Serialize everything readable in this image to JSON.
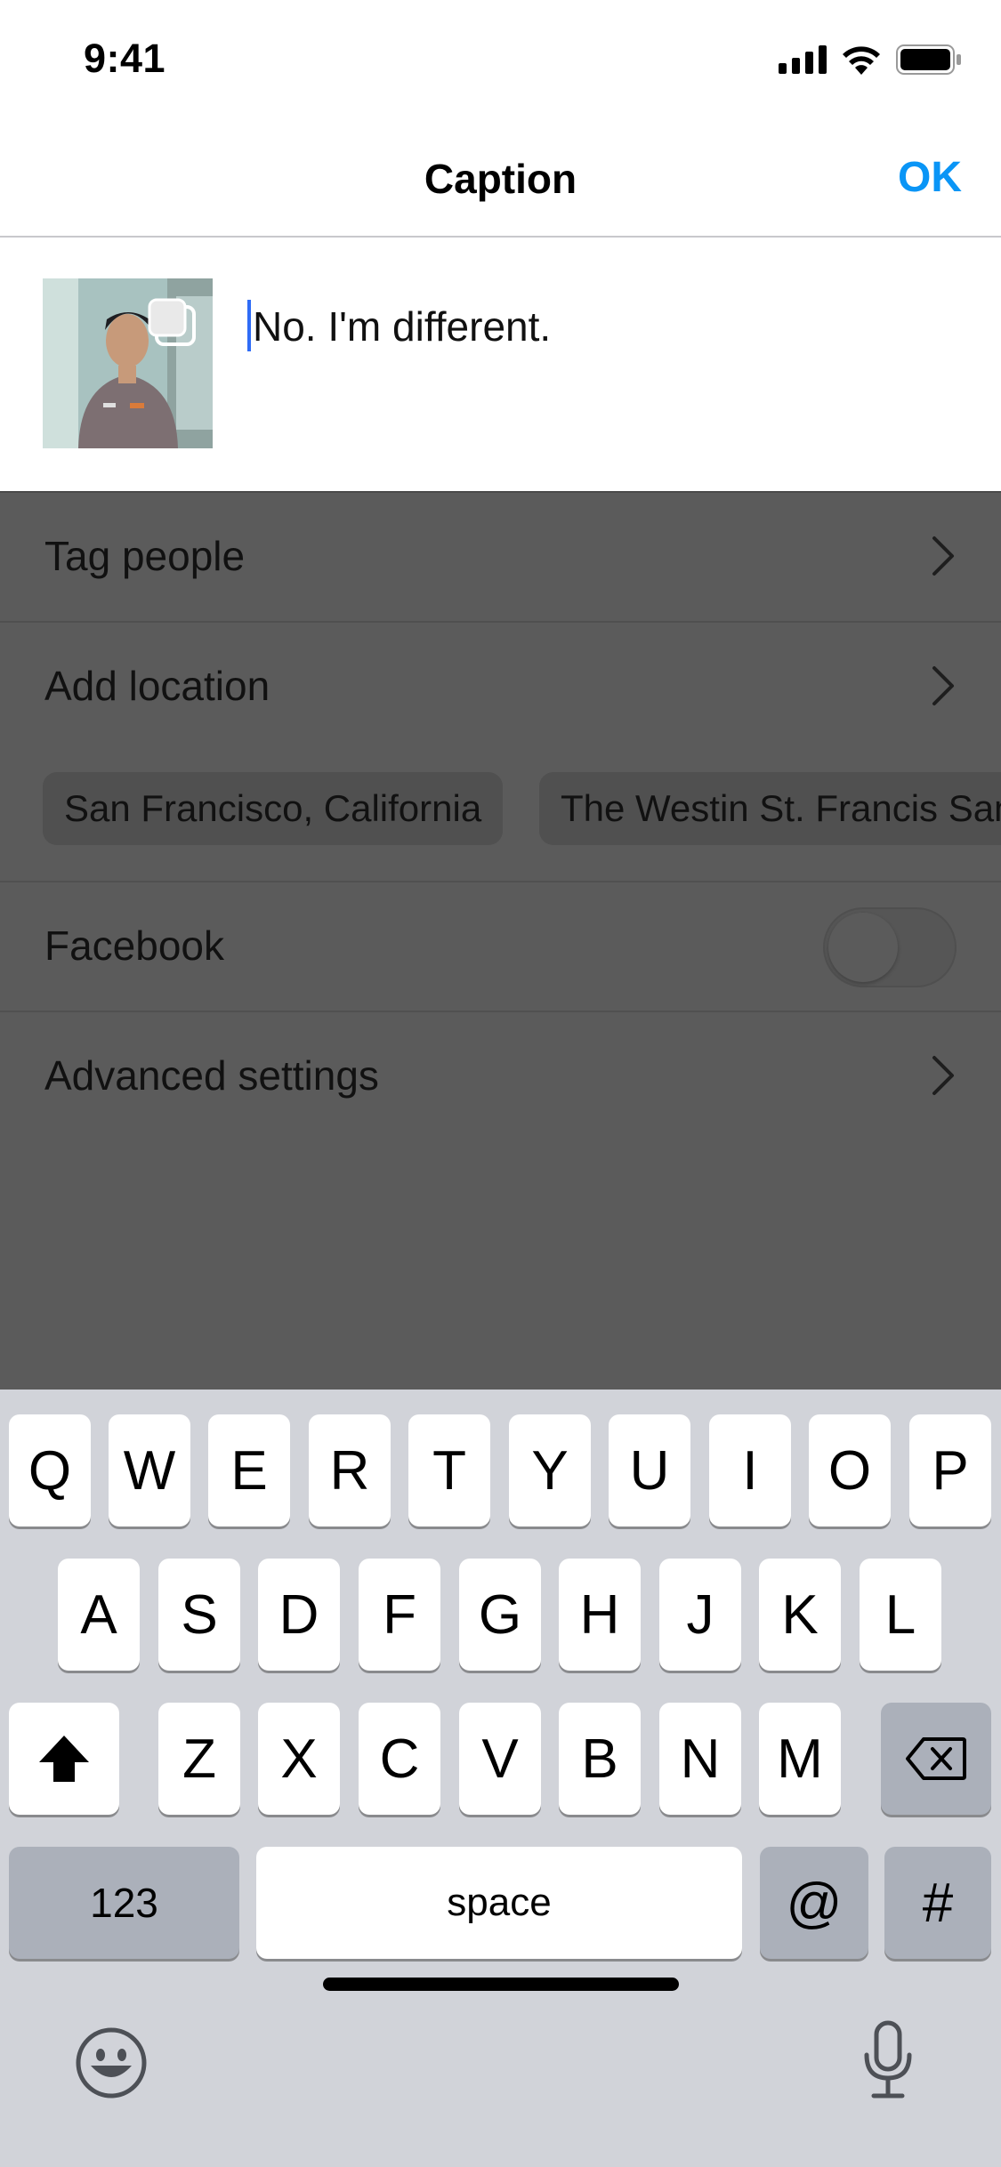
{
  "status_bar": {
    "time": "9:41"
  },
  "nav": {
    "title": "Caption",
    "ok_label": "OK"
  },
  "caption": {
    "text": "No. I'm different."
  },
  "rows": {
    "tag_people": "Tag people",
    "add_location": "Add location",
    "facebook": "Facebook",
    "facebook_enabled": false,
    "advanced_settings": "Advanced settings"
  },
  "location_suggestions": [
    "San Francisco, California",
    "The Westin St. Francis San Francisco"
  ],
  "keyboard": {
    "row1": [
      "Q",
      "W",
      "E",
      "R",
      "T",
      "Y",
      "U",
      "I",
      "O",
      "P"
    ],
    "row2": [
      "A",
      "S",
      "D",
      "F",
      "G",
      "H",
      "J",
      "K",
      "L"
    ],
    "row3": [
      "Z",
      "X",
      "C",
      "V",
      "B",
      "N",
      "M"
    ],
    "numbers_label": "123",
    "space_label": "space",
    "at_label": "@",
    "hash_label": "#"
  },
  "icons": {
    "shift": "shift-icon",
    "backspace": "backspace-icon",
    "emoji": "emoji-icon",
    "mic": "microphone-icon",
    "chevron": "chevron-right-icon"
  },
  "colors": {
    "accent": "#0a95f6",
    "overlay": "#5b5b5b",
    "keyboard_bg": "#d1d3d9"
  }
}
